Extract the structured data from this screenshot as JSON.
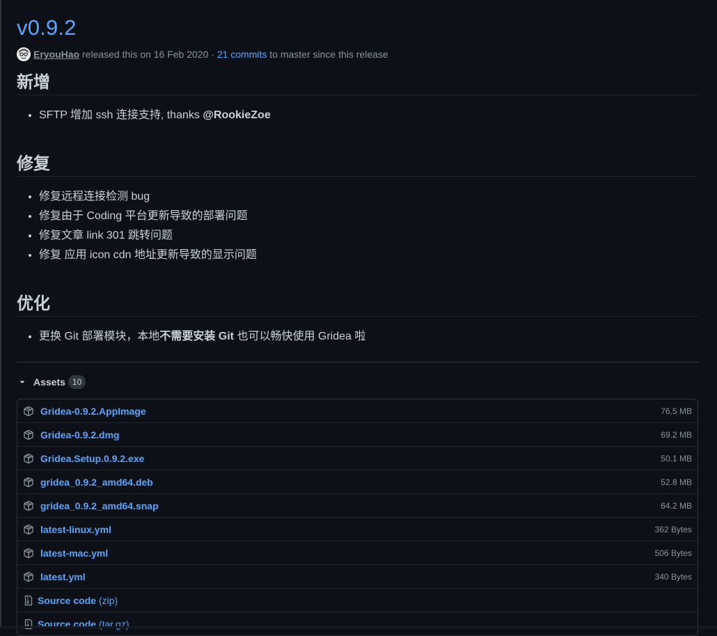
{
  "release": {
    "title": "v0.9.2",
    "author": "EryouHao",
    "released_text": " released this on 16 Feb 2020 · ",
    "commits_text": "21 commits",
    "since_text": " to master since this release"
  },
  "sections": {
    "new": {
      "heading": "新增",
      "item_prefix": "SFTP 增加 ssh 连接支持, thanks ",
      "item_mention": "@RookieZoe"
    },
    "fix": {
      "heading": "修复",
      "items": [
        "修复远程连接检测 bug",
        "修复由于 Coding 平台更新导致的部署问题",
        "修复文章 link 301 跳转问题",
        "修复 应用 icon cdn 地址更新导致的显示问题"
      ]
    },
    "optimize": {
      "heading": "优化",
      "item_prefix": "更换 Git 部署模块，本地",
      "item_bold": "不需要安装 Git",
      "item_suffix": " 也可以畅快使用 Gridea 啦"
    }
  },
  "assets": {
    "label": "Assets",
    "count": "10",
    "files": [
      {
        "name": "Gridea-0.9.2.AppImage",
        "size": "76.5 MB",
        "icon": "package-icon"
      },
      {
        "name": "Gridea-0.9.2.dmg",
        "size": "69.2 MB",
        "icon": "package-icon"
      },
      {
        "name": "Gridea.Setup.0.9.2.exe",
        "size": "50.1 MB",
        "icon": "package-icon"
      },
      {
        "name": "gridea_0.9.2_amd64.deb",
        "size": "52.8 MB",
        "icon": "package-icon"
      },
      {
        "name": "gridea_0.9.2_amd64.snap",
        "size": "64.2 MB",
        "icon": "package-icon"
      },
      {
        "name": "latest-linux.yml",
        "size": "362 Bytes",
        "icon": "package-icon"
      },
      {
        "name": "latest-mac.yml",
        "size": "506 Bytes",
        "icon": "package-icon"
      },
      {
        "name": "latest.yml",
        "size": "340 Bytes",
        "icon": "package-icon"
      }
    ],
    "source": [
      {
        "name": "Source code",
        "suffix": " (zip)",
        "icon": "file-zip-icon"
      },
      {
        "name": "Source code",
        "suffix": " (tar.gz)",
        "icon": "file-zip-icon"
      }
    ]
  },
  "colors": {
    "background": "#0d1117",
    "link": "#58a6ff",
    "text": "#c9d1d9",
    "muted": "#8b949e",
    "border": "#30363d"
  }
}
